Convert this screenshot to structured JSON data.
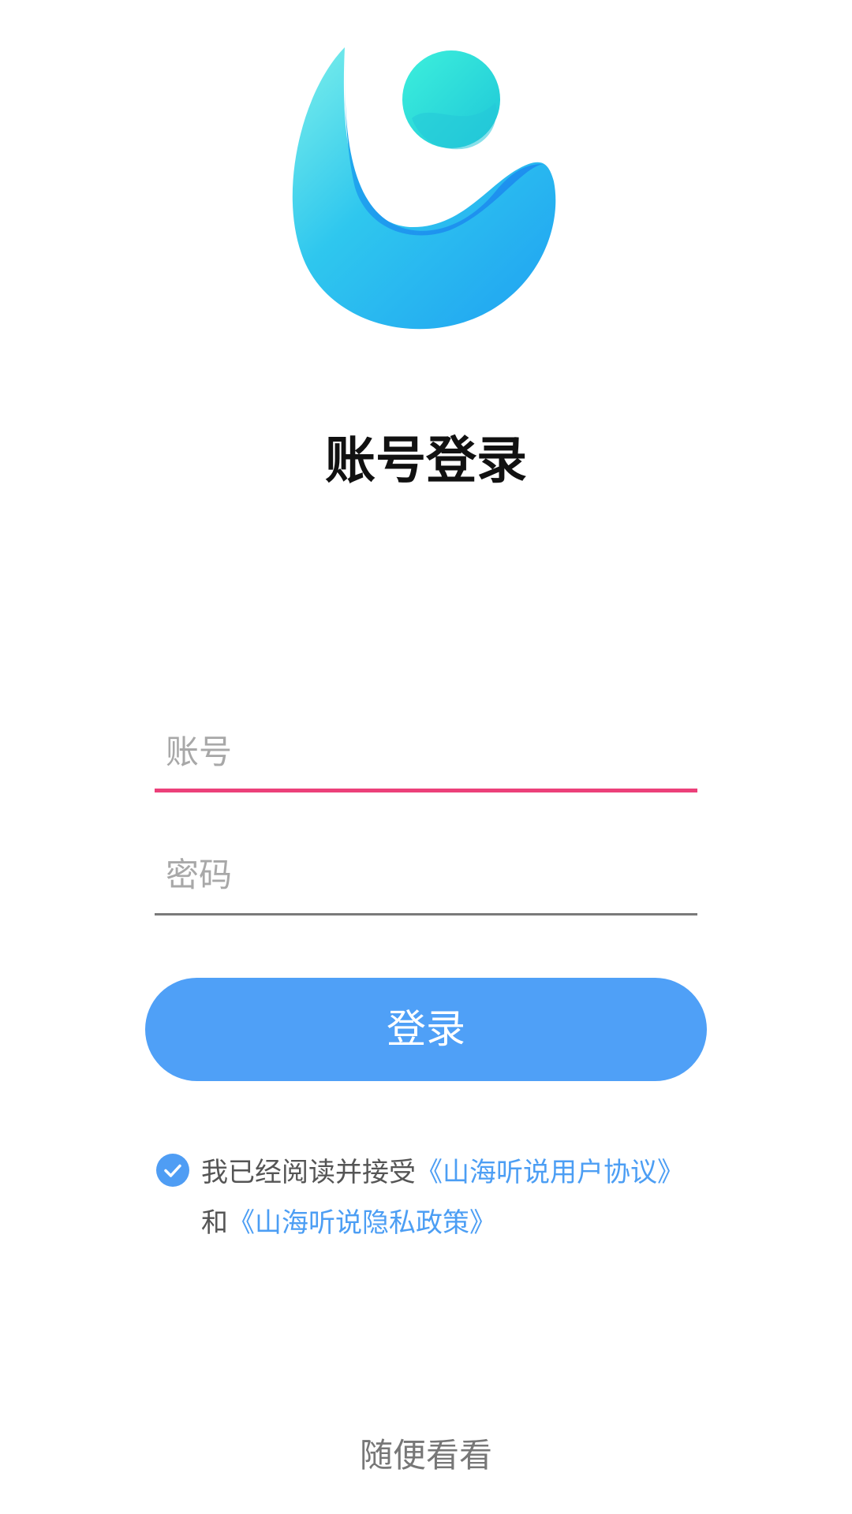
{
  "logo": {
    "icon": "app-logo-icon"
  },
  "title": "账号登录",
  "form": {
    "account_placeholder": "账号",
    "account_value": "",
    "password_placeholder": "密码",
    "password_value": ""
  },
  "login_button": "登录",
  "agreement": {
    "checked": true,
    "prefix": "我已经阅读并接受",
    "user_agreement_link": "《山海听说用户协议》",
    "connector": "和",
    "privacy_policy_link": "《山海听说隐私政策》"
  },
  "browse_link": "随便看看",
  "colors": {
    "primary": "#4fa0f7",
    "focus_underline": "#ec407a",
    "link": "#4c9ef4",
    "logo_cyan": "#33dfe0",
    "logo_blue": "#1f8ef0"
  }
}
